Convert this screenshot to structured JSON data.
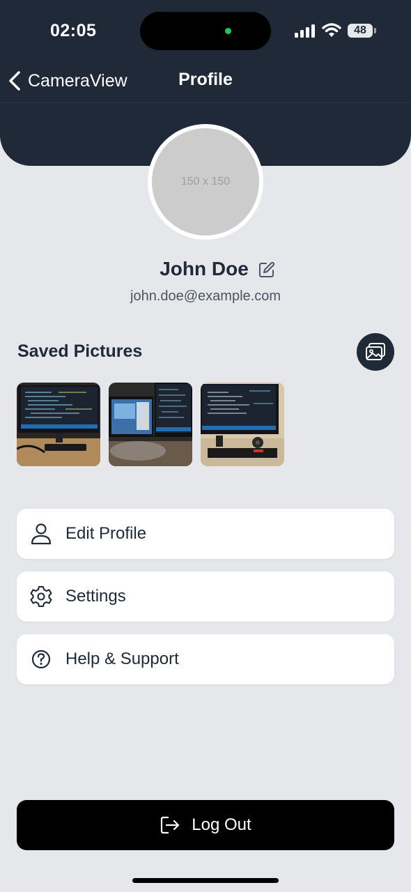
{
  "status_bar": {
    "time": "02:05",
    "battery": "48",
    "icons": [
      "cellular-signal-icon",
      "wifi-icon",
      "battery-icon"
    ]
  },
  "nav": {
    "back_label": "CameraView",
    "title": "Profile"
  },
  "profile": {
    "avatar_placeholder": "150 x 150",
    "name": "John Doe",
    "email": "john.doe@example.com"
  },
  "saved_pictures": {
    "title": "Saved Pictures",
    "thumbnails": [
      "monitor-code-photo",
      "dual-monitor-desk-photo",
      "monitor-code-speaker-photo"
    ]
  },
  "menu": {
    "items": [
      {
        "label": "Edit Profile",
        "icon": "user-icon"
      },
      {
        "label": "Settings",
        "icon": "gear-icon"
      },
      {
        "label": "Help & Support",
        "icon": "help-circle-icon"
      }
    ]
  },
  "logout": {
    "label": "Log Out",
    "icon": "logout-icon"
  },
  "colors": {
    "header_bg": "#1f2937",
    "page_bg": "#e5e7eb",
    "card_bg": "#ffffff",
    "logout_bg": "#000000",
    "camera_indicator": "#22c55e"
  }
}
